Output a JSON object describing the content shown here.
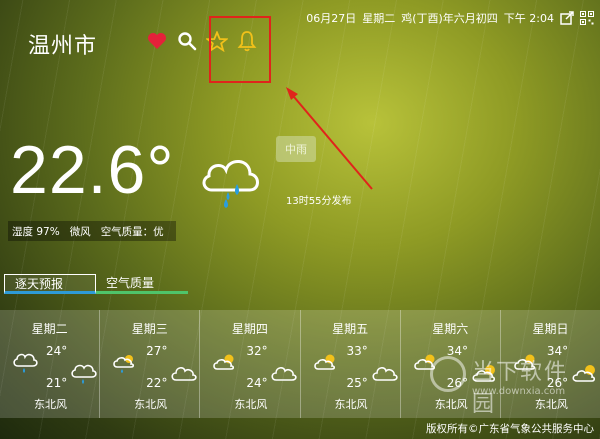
{
  "header": {
    "city": "温州市",
    "date": "06月27日",
    "weekday": "星期二",
    "lunar": "鸡(丁酉)年六月初四",
    "time": "下午 2:04"
  },
  "current": {
    "temperature": "22.6°",
    "condition": "中雨",
    "published": "13时55分发布",
    "humidity": "湿度 97%",
    "wind": "微风",
    "air_quality": "空气质量：优"
  },
  "tabs": [
    {
      "label": "逐天预报"
    },
    {
      "label": "空气质量"
    }
  ],
  "forecast": [
    {
      "day": "星期二",
      "high": "24°",
      "low": "21°",
      "wind": "东北风"
    },
    {
      "day": "星期三",
      "high": "27°",
      "low": "22°",
      "wind": "东北风"
    },
    {
      "day": "星期四",
      "high": "32°",
      "low": "24°",
      "wind": "东北风"
    },
    {
      "day": "星期五",
      "high": "33°",
      "low": "25°",
      "wind": "东北风"
    },
    {
      "day": "星期六",
      "high": "34°",
      "low": "26°",
      "wind": "东北风"
    },
    {
      "day": "星期日",
      "high": "34°",
      "low": "26°",
      "wind": "东北风"
    }
  ],
  "footer": {
    "copyright": "版权所有©广东省气象公共服务中心"
  },
  "watermark": {
    "name": "当下软件园",
    "url": "www.downxia.com"
  },
  "colors": {
    "highlight": "#e0241b",
    "heart": "#e5213a",
    "star": "#f2c11a",
    "bell": "#f2c11a",
    "rain_drop": "#2a9ee0",
    "tab_active": "#2e9bd6",
    "tab_normal": "#4fc46a"
  }
}
